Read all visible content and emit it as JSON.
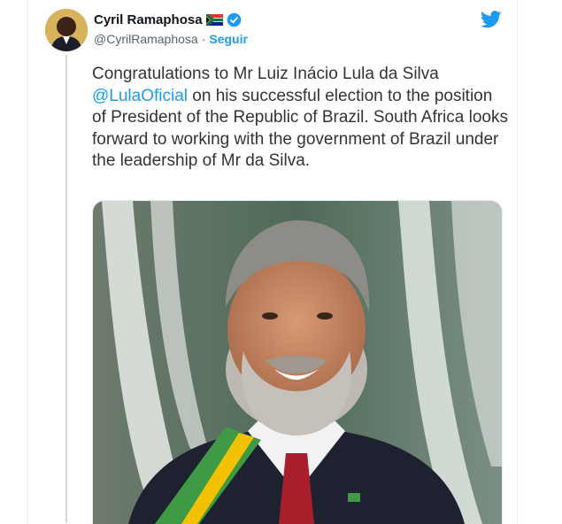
{
  "tweet": {
    "author": {
      "display_name": "Cyril Ramaphosa",
      "handle": "@CyrilRamaphosa",
      "separator": "·",
      "follow_label": "Seguir"
    },
    "text_before_mention": "Congratulations to Mr Luiz Inácio Lula da Silva ",
    "mention": "@LulaOficial",
    "text_after_mention": " on his successful election to the position of President of the Republic of Brazil. South Africa looks forward to working with the government of Brazil under the leadership of Mr da Silva."
  },
  "colors": {
    "accent": "#1d9bf0",
    "text": "#333333",
    "muted": "#536471"
  },
  "icons": {
    "logo": "twitter-bird-icon",
    "verified": "verified-badge-icon",
    "flag": "south-africa-flag-icon"
  }
}
